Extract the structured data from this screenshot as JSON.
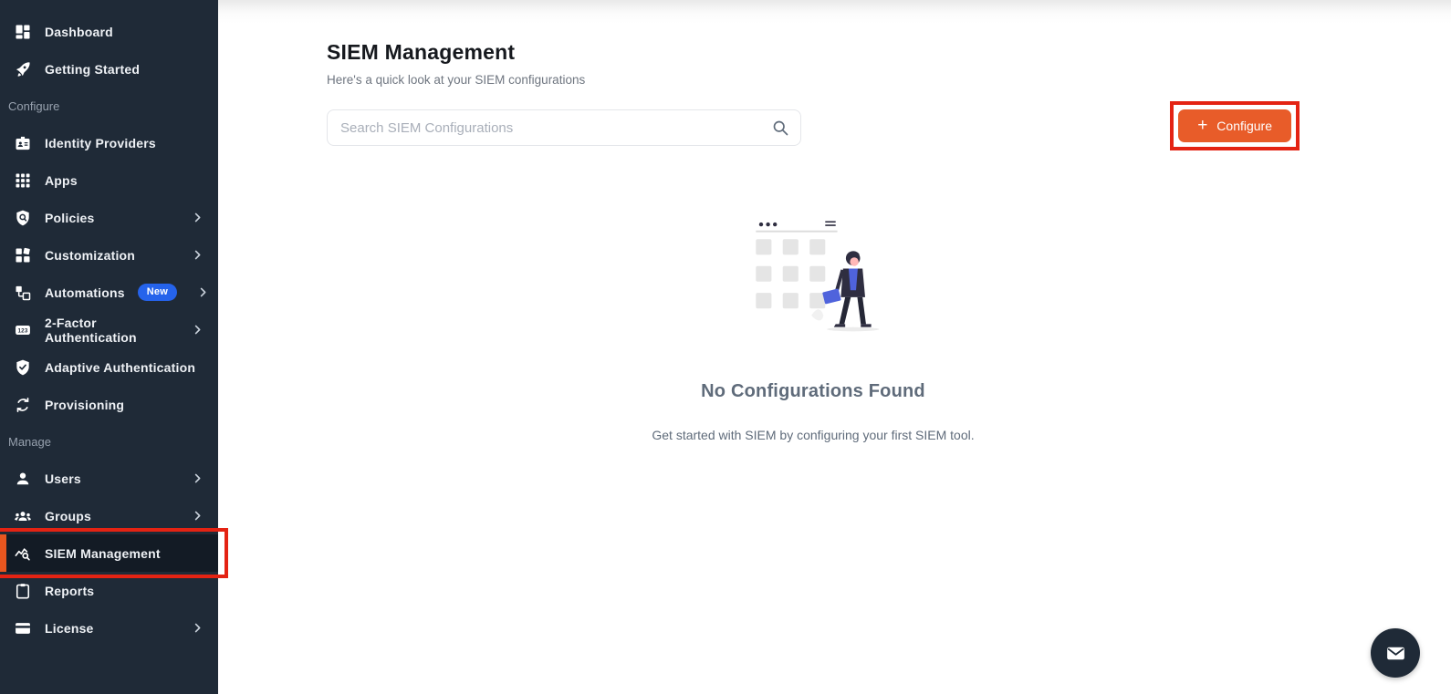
{
  "sidebar": {
    "items": [
      {
        "label": "Dashboard",
        "icon": "dashboard-icon"
      },
      {
        "label": "Getting Started",
        "icon": "rocket-icon"
      },
      {
        "label": "Configure",
        "type": "section"
      },
      {
        "label": "Identity Providers",
        "icon": "id-badge-icon"
      },
      {
        "label": "Apps",
        "icon": "apps-grid-icon"
      },
      {
        "label": "Policies",
        "icon": "shield-policy-icon",
        "chevron": true
      },
      {
        "label": "Customization",
        "icon": "customization-icon",
        "chevron": true
      },
      {
        "label": "Automations",
        "icon": "automations-icon",
        "badge": "New",
        "chevron": true
      },
      {
        "label": "2-Factor Authentication",
        "icon": "otp-123-icon",
        "chevron": true
      },
      {
        "label": "Adaptive Authentication",
        "icon": "shield-check-icon"
      },
      {
        "label": "Provisioning",
        "icon": "sync-icon"
      },
      {
        "label": "Manage",
        "type": "section"
      },
      {
        "label": "Users",
        "icon": "user-icon",
        "chevron": true
      },
      {
        "label": "Groups",
        "icon": "users-group-icon",
        "chevron": true
      },
      {
        "label": "SIEM Management",
        "icon": "chart-search-icon",
        "active": true,
        "annotated": true
      },
      {
        "label": "Reports",
        "icon": "clipboard-icon"
      },
      {
        "label": "License",
        "icon": "credit-card-icon",
        "chevron": true
      }
    ]
  },
  "header": {
    "title": "SIEM Management",
    "subtitle": "Here's a quick look at your SIEM configurations"
  },
  "search": {
    "placeholder": "Search SIEM Configurations",
    "icon": "search-icon"
  },
  "toolbar": {
    "configure_label": "Configure",
    "plus": "+"
  },
  "empty_state": {
    "title": "No Configurations Found",
    "subtitle": "Get started with SIEM by configuring your first SIEM tool.",
    "illustration": "empty-config-illustration"
  },
  "contact": {
    "icon": "envelope-icon"
  },
  "colors": {
    "sidebar_bg": "#1F2A37",
    "active_item_bg": "#131B25",
    "active_accent_orange": "#E8561F",
    "button_orange": "#E85C29",
    "annotation_red": "#E42313",
    "badge_blue": "#2563EB",
    "illustration_blue": "#4F63DC",
    "illustration_dark": "#2F2E41"
  }
}
